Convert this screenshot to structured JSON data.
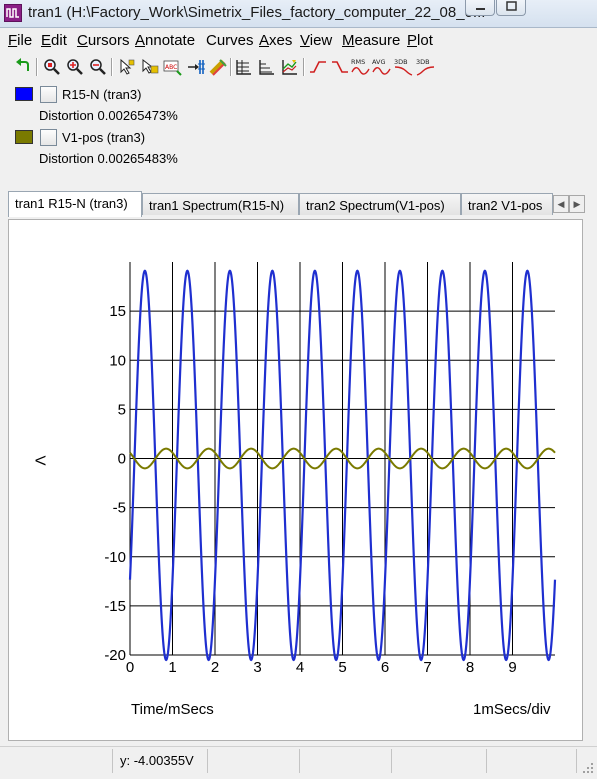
{
  "window": {
    "title": "tran1 (H:\\Factory_Work\\Simetrix_Files_factory_computer_22_08_0...",
    "app_icon": "simetrix-waveform-icon",
    "buttons": [
      "minimize-icon",
      "maximize-icon"
    ]
  },
  "menu": [
    {
      "label": "File",
      "mnemonic": "F",
      "rest": "ile"
    },
    {
      "label": "Edit",
      "mnemonic": "E",
      "rest": "dit"
    },
    {
      "label": "Cursors",
      "mnemonic": "C",
      "rest": "ursors"
    },
    {
      "label": "Annotate",
      "mnemonic": "A",
      "rest": "nnotate"
    },
    {
      "label": "Curves",
      "mnemonic": "Cur",
      "rest": "ves"
    },
    {
      "label": "Axes",
      "mnemonic": "A",
      "rest": "xes"
    },
    {
      "label": "View",
      "mnemonic": "V",
      "rest": "iew"
    },
    {
      "label": "Measure",
      "mnemonic": "M",
      "rest": "easure"
    },
    {
      "label": "Plot",
      "mnemonic": "P",
      "rest": "lot"
    }
  ],
  "toolbar": {
    "rms_label": "RMS",
    "avg_label": "AVG",
    "db_label": "3DB",
    "db2_label": "3DB",
    "icons": [
      "undo-zoom-icon",
      "zoom-full-icon",
      "zoom-in-icon",
      "zoom-out-icon",
      "cursor-toggle-icon",
      "cursor-step-icon",
      "annotate-label-icon",
      "add-curve-icon",
      "delete-curve-icon",
      "grid-icon",
      "axis-icon",
      "stack-icon",
      "rise-time-icon",
      "fall-time-icon",
      "rms-icon",
      "average-icon",
      "3db-icon",
      "3db-low-icon"
    ]
  },
  "legend": [
    {
      "name": "R15-N (tran3)",
      "measurement": "Distortion  0.00265473%",
      "color": "#0000ff"
    },
    {
      "name": "V1-pos (tran3)",
      "measurement": "Distortion  0.00265483%",
      "color": "#7a7a00"
    }
  ],
  "tabs": [
    {
      "label": "tran1 R15-N (tran3)",
      "active": true
    },
    {
      "label": "tran1 Spectrum(R15-N)",
      "active": false
    },
    {
      "label": "tran2 Spectrum(V1-pos)",
      "active": false
    },
    {
      "label": "tran2 V1-pos",
      "active": false
    }
  ],
  "plot": {
    "ylabel": "V",
    "xlabel": "Time/mSecs",
    "xdiv_label": "1mSecs/div"
  },
  "chart_data": {
    "type": "line",
    "ylabel": "V",
    "xlabel": "Time/mSecs",
    "xlim": [
      0,
      10
    ],
    "ylim": [
      -20,
      20
    ],
    "yticks": [
      -20,
      -15,
      -10,
      -5,
      0,
      5,
      10,
      15
    ],
    "xticks": [
      0,
      1,
      2,
      3,
      4,
      5,
      6,
      7,
      8,
      9
    ],
    "grid": true,
    "series": [
      {
        "name": "R15-N (tran3)",
        "color": "#1f2fd0",
        "waveform": "sine",
        "amplitude": 19.8,
        "offset": -0.7,
        "frequency_per_ms": 1.0,
        "phase_deg": 324
      },
      {
        "name": "V1-pos (tran3)",
        "color": "#7a7a00",
        "waveform": "sine",
        "amplitude": 1.0,
        "offset": 0.0,
        "frequency_per_ms": 1.0,
        "phase_deg": 144
      }
    ]
  },
  "status": {
    "cursor_readout": "y: -4.00355V"
  }
}
